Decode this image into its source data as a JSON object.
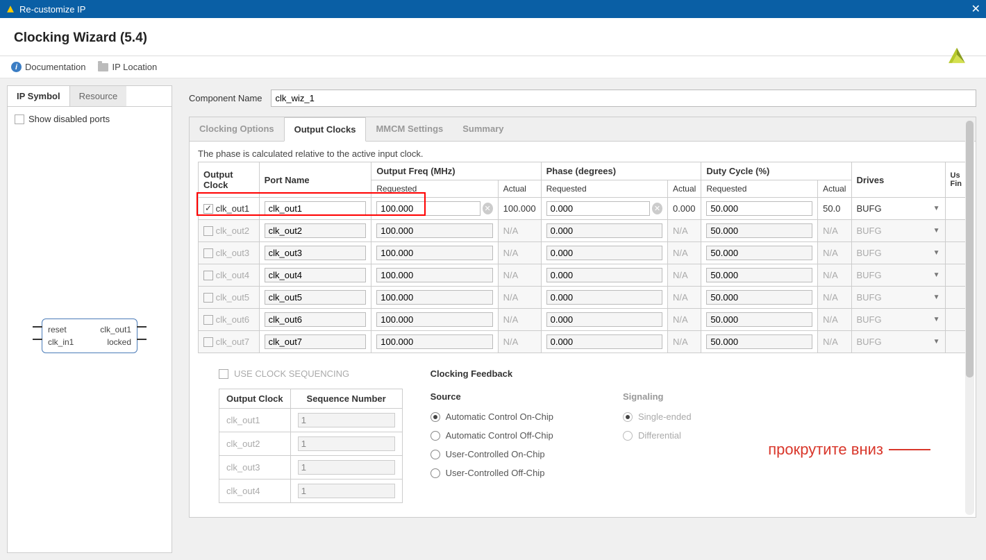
{
  "window": {
    "title": "Re-customize IP"
  },
  "header": {
    "title": "Clocking Wizard (5.4)"
  },
  "toolbar": {
    "documentation": "Documentation",
    "ip_location": "IP Location"
  },
  "side_tabs": {
    "ip_symbol": "IP Symbol",
    "resource": "Resource"
  },
  "side": {
    "show_disabled_ports": "Show disabled ports"
  },
  "ip_block": {
    "p_reset": "reset",
    "p_clkin1": "clk_in1",
    "p_clkout1": "clk_out1",
    "p_locked": "locked"
  },
  "comp": {
    "label": "Component Name",
    "value": "clk_wiz_1"
  },
  "tabs": {
    "clocking_options": "Clocking Options",
    "output_clocks": "Output Clocks",
    "mmcm_settings": "MMCM Settings",
    "summary": "Summary"
  },
  "note": "The phase is calculated relative to the active input clock.",
  "cols": {
    "output_clock": "Output Clock",
    "port_name": "Port Name",
    "freq": "Output Freq (MHz)",
    "phase": "Phase (degrees)",
    "duty": "Duty Cycle (%)",
    "requested": "Requested",
    "actual": "Actual",
    "drives": "Drives",
    "use_fine": "Us\nFin"
  },
  "rows": [
    {
      "en": true,
      "name": "clk_out1",
      "port": "clk_out1",
      "freq_req": "100.000",
      "freq_act": "100.000",
      "ph_req": "0.000",
      "ph_act": "0.000",
      "duty_req": "50.000",
      "duty_act": "50.0",
      "drives": "BUFG"
    },
    {
      "en": false,
      "name": "clk_out2",
      "port": "clk_out2",
      "freq_req": "100.000",
      "freq_act": "N/A",
      "ph_req": "0.000",
      "ph_act": "N/A",
      "duty_req": "50.000",
      "duty_act": "N/A",
      "drives": "BUFG"
    },
    {
      "en": false,
      "name": "clk_out3",
      "port": "clk_out3",
      "freq_req": "100.000",
      "freq_act": "N/A",
      "ph_req": "0.000",
      "ph_act": "N/A",
      "duty_req": "50.000",
      "duty_act": "N/A",
      "drives": "BUFG"
    },
    {
      "en": false,
      "name": "clk_out4",
      "port": "clk_out4",
      "freq_req": "100.000",
      "freq_act": "N/A",
      "ph_req": "0.000",
      "ph_act": "N/A",
      "duty_req": "50.000",
      "duty_act": "N/A",
      "drives": "BUFG"
    },
    {
      "en": false,
      "name": "clk_out5",
      "port": "clk_out5",
      "freq_req": "100.000",
      "freq_act": "N/A",
      "ph_req": "0.000",
      "ph_act": "N/A",
      "duty_req": "50.000",
      "duty_act": "N/A",
      "drives": "BUFG"
    },
    {
      "en": false,
      "name": "clk_out6",
      "port": "clk_out6",
      "freq_req": "100.000",
      "freq_act": "N/A",
      "ph_req": "0.000",
      "ph_act": "N/A",
      "duty_req": "50.000",
      "duty_act": "N/A",
      "drives": "BUFG"
    },
    {
      "en": false,
      "name": "clk_out7",
      "port": "clk_out7",
      "freq_req": "100.000",
      "freq_act": "N/A",
      "ph_req": "0.000",
      "ph_act": "N/A",
      "duty_req": "50.000",
      "duty_act": "N/A",
      "drives": "BUFG"
    }
  ],
  "seq": {
    "title": "USE CLOCK SEQUENCING",
    "col1": "Output Clock",
    "col2": "Sequence Number",
    "rows": [
      {
        "name": "clk_out1",
        "seq": "1"
      },
      {
        "name": "clk_out2",
        "seq": "1"
      },
      {
        "name": "clk_out3",
        "seq": "1"
      },
      {
        "name": "clk_out4",
        "seq": "1"
      }
    ]
  },
  "feedback": {
    "title": "Clocking Feedback",
    "source": "Source",
    "signaling": "Signaling",
    "src_opts": [
      "Automatic Control On-Chip",
      "Automatic Control Off-Chip",
      "User-Controlled On-Chip",
      "User-Controlled Off-Chip"
    ],
    "sig_opts": [
      "Single-ended",
      "Differential"
    ]
  },
  "annotation": "прокрутите вниз"
}
